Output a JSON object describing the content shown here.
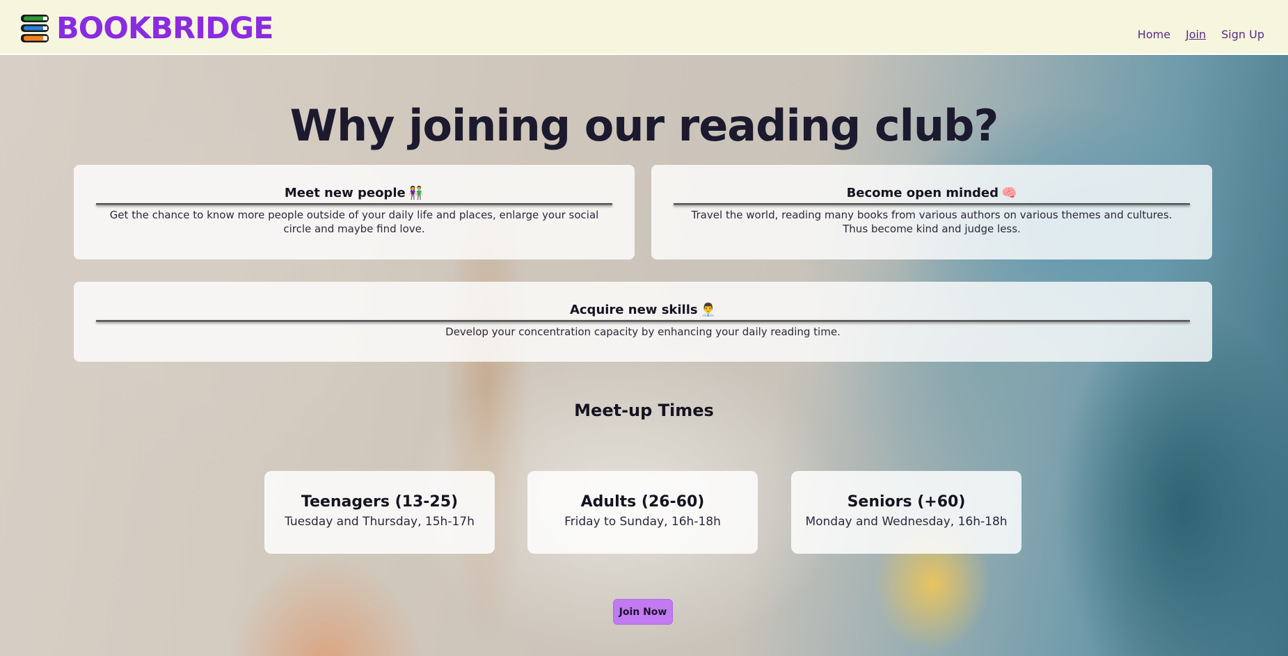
{
  "brand": {
    "name": "BOOKBRIDGE",
    "logo_icon": "books-stack-icon",
    "color": "#8a2be2"
  },
  "nav": {
    "items": [
      {
        "label": "Home",
        "active": false
      },
      {
        "label": "Join",
        "active": true
      },
      {
        "label": "Sign Up",
        "active": false
      }
    ]
  },
  "hero": {
    "title": "Why joining our reading club?"
  },
  "benefits": [
    {
      "title": "Meet new people",
      "emoji": "👫",
      "icon": "people-holding-hands-icon",
      "text": "Get the chance to know more people outside of your daily life and places, enlarge your social circle and maybe find love."
    },
    {
      "title": "Become open minded",
      "emoji": "🧠",
      "icon": "brain-icon",
      "text": "Travel the world, reading many books from various authors on various themes and cultures. Thus become kind and judge less."
    },
    {
      "title": "Acquire new skills",
      "emoji": "👨‍💼",
      "icon": "office-worker-icon",
      "text": "Develop your concentration capacity by enhancing your daily reading time."
    }
  ],
  "meetups": {
    "title": "Meet-up Times",
    "groups": [
      {
        "name": "Teenagers (13-25)",
        "time": "Tuesday and Thursday, 15h-17h"
      },
      {
        "name": "Adults (26-60)",
        "time": "Friday to Sunday, 16h-18h"
      },
      {
        "name": "Seniors (+60)",
        "time": "Monday and Wednesday, 16h-18h"
      }
    ]
  },
  "cta": {
    "label": "Join Now",
    "color": "#c17af2"
  },
  "colors": {
    "header_bg": "#f6f5dd",
    "nav_link": "#5a2a86",
    "text_dark": "#1c1a2e"
  }
}
